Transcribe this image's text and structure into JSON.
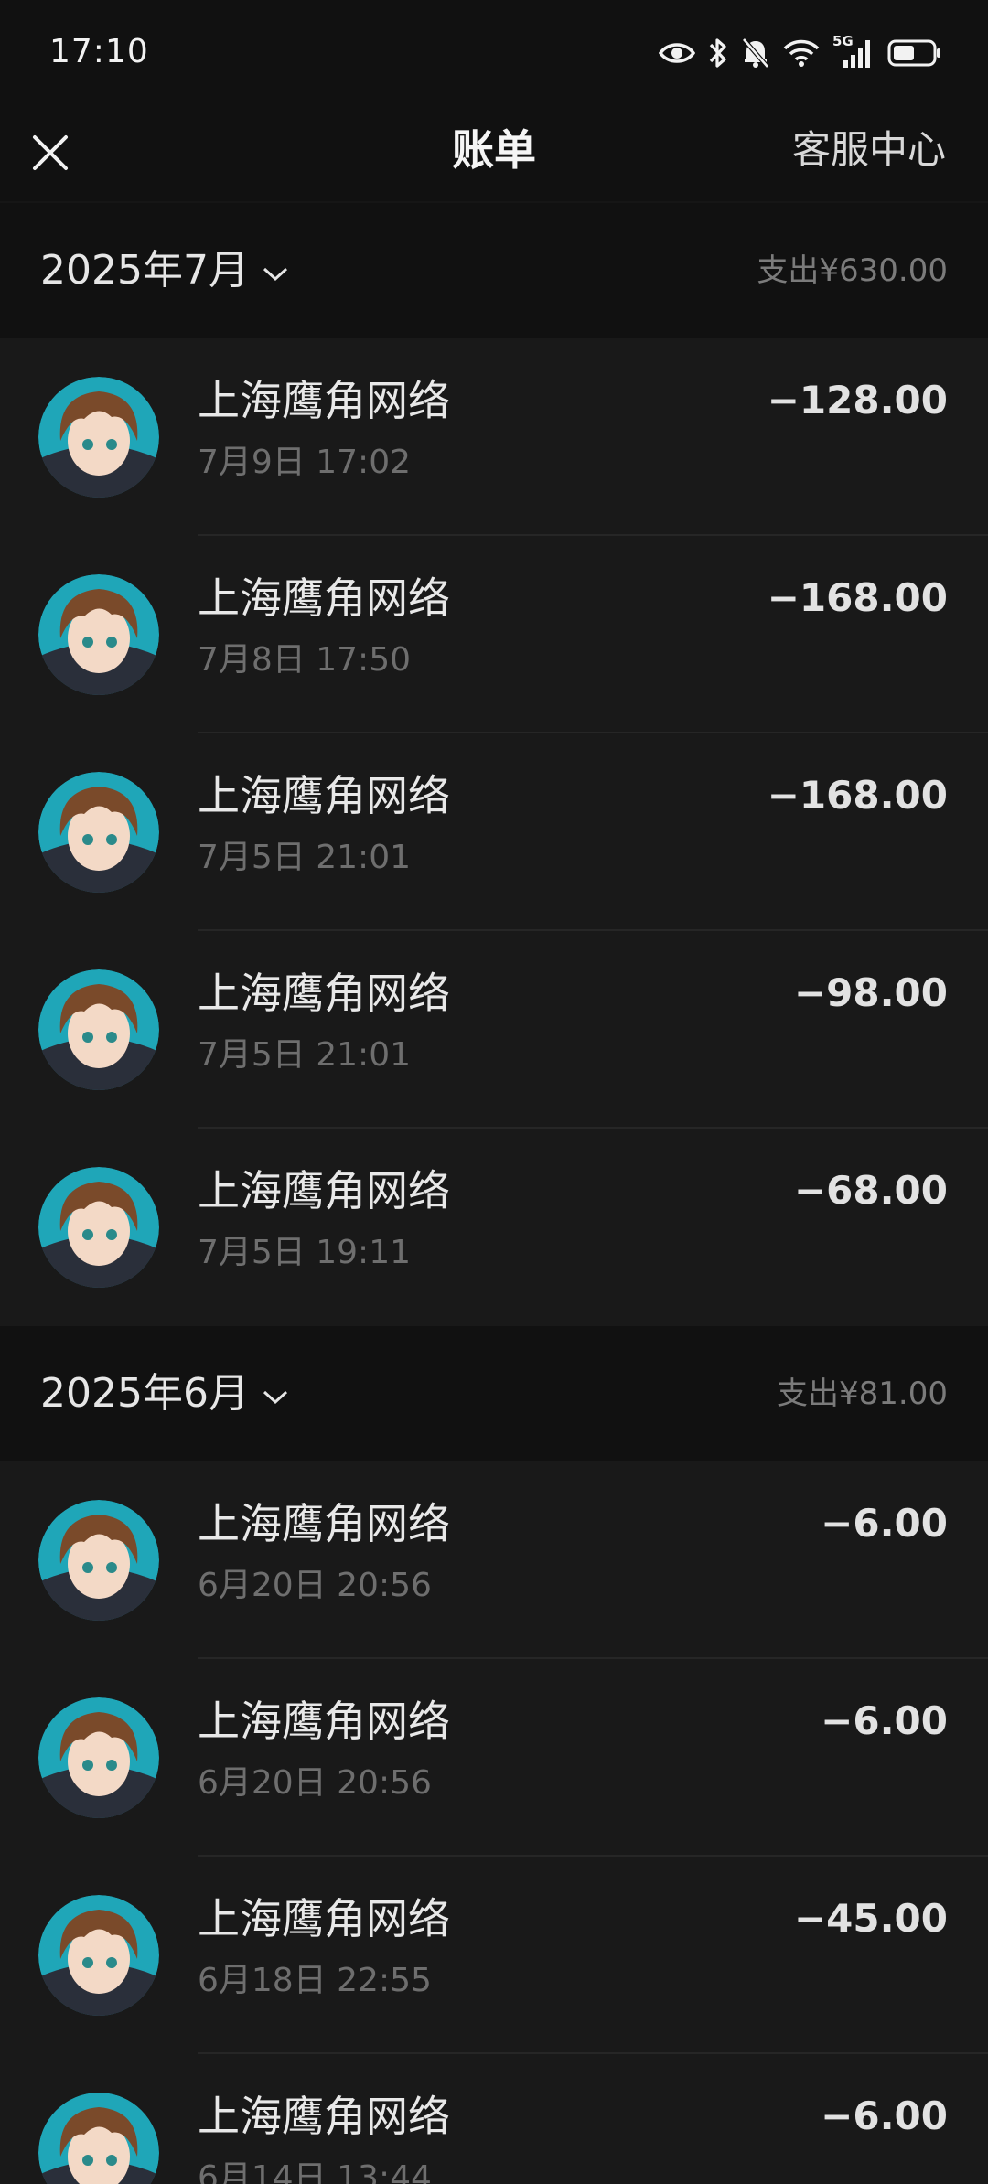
{
  "status_bar": {
    "time": "17:10",
    "network": "5G",
    "icons": [
      "eye-icon",
      "bluetooth-icon",
      "bell-off-icon",
      "wifi-icon",
      "signal-icon",
      "battery-icon"
    ]
  },
  "nav": {
    "close_icon": "close-icon",
    "title": "账单",
    "right_label": "客服中心"
  },
  "sections": [
    {
      "month": "2025年7月",
      "summary": "支出¥630.00",
      "items": [
        {
          "title": "上海鹰角网络",
          "time": "7月9日 17:02",
          "amount": "−128.00"
        },
        {
          "title": "上海鹰角网络",
          "time": "7月8日 17:50",
          "amount": "−168.00"
        },
        {
          "title": "上海鹰角网络",
          "time": "7月5日 21:01",
          "amount": "−168.00"
        },
        {
          "title": "上海鹰角网络",
          "time": "7月5日 21:01",
          "amount": "−98.00"
        },
        {
          "title": "上海鹰角网络",
          "time": "7月5日 19:11",
          "amount": "−68.00"
        }
      ]
    },
    {
      "month": "2025年6月",
      "summary": "支出¥81.00",
      "items": [
        {
          "title": "上海鹰角网络",
          "time": "6月20日 20:56",
          "amount": "−6.00"
        },
        {
          "title": "上海鹰角网络",
          "time": "6月20日 20:56",
          "amount": "−6.00"
        },
        {
          "title": "上海鹰角网络",
          "time": "6月18日 22:55",
          "amount": "−45.00"
        },
        {
          "title": "上海鹰角网络",
          "time": "6月14日 13:44",
          "amount": "−6.00"
        }
      ]
    }
  ],
  "colors": {
    "background": "#111111",
    "list_background": "#191919",
    "primary_text": "#e8e8e8",
    "secondary_text": "#6e6e6e",
    "avatar_accent": "#1fa6b8"
  }
}
